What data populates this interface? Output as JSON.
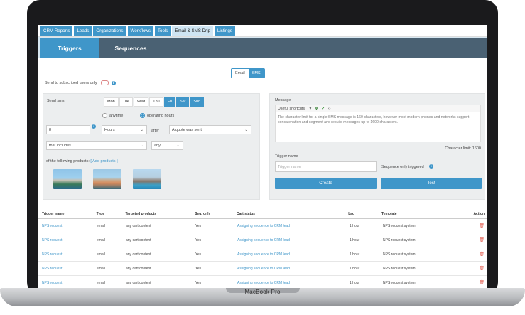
{
  "device": {
    "label": "MacBook Pro"
  },
  "topnav": {
    "tabs": [
      "CRM Reports",
      "Leads",
      "Organizations",
      "Workflows",
      "Tools",
      "Email & SMS Drip",
      "Listings"
    ],
    "active": "Email & SMS Drip"
  },
  "subtabs": {
    "triggers": "Triggers",
    "sequences": "Sequences"
  },
  "channel": {
    "email": "Email",
    "sms": "SMS"
  },
  "subscribed": {
    "label": "Send to subscribed users only",
    "toggle": "OFF"
  },
  "send": {
    "label": "Send sms",
    "days": [
      {
        "label": "Mon",
        "on": false
      },
      {
        "label": "Tue",
        "on": false
      },
      {
        "label": "Wed",
        "on": false
      },
      {
        "label": "Thu",
        "on": false
      },
      {
        "label": "Fri",
        "on": true
      },
      {
        "label": "Sat",
        "on": true
      },
      {
        "label": "Sun",
        "on": true
      }
    ],
    "anytime": "anytime",
    "operating": "operating hours",
    "amount": "8",
    "unit": "Hours",
    "after": "after",
    "event": "A quote was sent",
    "condition": "that includes",
    "quantifier": "any",
    "products_label": "of the following products:",
    "add_products": "[ Add products ]"
  },
  "message": {
    "label": "Message",
    "shortcuts": "Useful shortcuts",
    "body": "The character limit for a single SMS message is 160 characters, however most modern phones and networks support concatenation and segment and rebuild messages up to 1600 characters.",
    "char_limit": "Character limit: 1600",
    "trigger_name_label": "Trigger name",
    "trigger_name_placeholder": "Trigger name",
    "seq_only": "Sequence only triggered",
    "create": "Create",
    "test": "Test"
  },
  "table": {
    "headers": [
      "Trigger name",
      "Type",
      "Targeted products",
      "Seq. only",
      "Cart status",
      "Lag",
      "Template",
      "Action"
    ],
    "rows": [
      [
        "NPS request",
        "email",
        "any cart content",
        "Yes",
        "Assigning sequence to CRM lead",
        "1 hour",
        "NPS request system"
      ],
      [
        "NPS request",
        "email",
        "any cart content",
        "Yes",
        "Assigning sequence to CRM lead",
        "1 hour",
        "NPS request system"
      ],
      [
        "NPS request",
        "email",
        "any cart content",
        "Yes",
        "Assigning sequence to CRM lead",
        "1 hour",
        "NPS request system"
      ],
      [
        "NPS request",
        "email",
        "any cart content",
        "Yes",
        "Assigning sequence to CRM lead",
        "1 hour",
        "NPS request system"
      ],
      [
        "NPS request",
        "email",
        "any cart content",
        "Yes",
        "Assigning sequence to CRM lead",
        "1 hour",
        "NPS request system"
      ]
    ]
  },
  "colors": {
    "accent": "#3f96c9",
    "header_dark": "#4a6173",
    "danger": "#e25a4d"
  }
}
